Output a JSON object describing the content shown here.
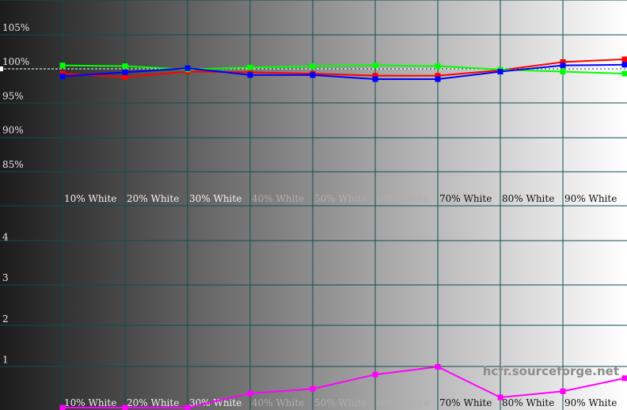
{
  "watermark": "hcfr.sourceforge.net",
  "colors": {
    "grid": "#0f4d4d",
    "red": "#ff0000",
    "green": "#00ff00",
    "blue": "#0000ff",
    "magenta": "#ff00ff",
    "reference": "#ffffff",
    "bg_start": "#1c1c1c",
    "bg_end": "#ffffff"
  },
  "chart_data": [
    {
      "type": "line",
      "categories": [
        "10% White",
        "20% White",
        "30% White",
        "40% White",
        "50% White",
        "60% White",
        "70% White",
        "80% White",
        "90% White"
      ],
      "x": [
        0,
        10,
        20,
        30,
        40,
        50,
        60,
        70,
        80,
        90,
        100
      ],
      "yticks": [
        "105%",
        "100%",
        "95%",
        "90%",
        "85%"
      ],
      "ylim": [
        80,
        110
      ],
      "reference_value": 100,
      "grid": true,
      "series": [
        {
          "color": "red",
          "values": [
            99.3,
            98.8,
            99.6,
            99.5,
            99.3,
            99.0,
            99.0,
            99.8,
            101.0,
            101.4
          ]
        },
        {
          "color": "green",
          "values": [
            100.5,
            100.4,
            99.9,
            100.2,
            100.4,
            100.5,
            100.4,
            99.9,
            99.6,
            99.3
          ]
        },
        {
          "color": "blue",
          "values": [
            98.9,
            99.5,
            100.1,
            99.1,
            99.1,
            98.5,
            98.5,
            99.6,
            100.5,
            100.6
          ]
        }
      ]
    },
    {
      "type": "line",
      "categories": [
        "10% White",
        "20% White",
        "30% White",
        "40% White",
        "50% White",
        "60% White",
        "70% White",
        "80% White",
        "90% White"
      ],
      "x": [
        0,
        10,
        20,
        30,
        40,
        50,
        60,
        70,
        80,
        90,
        100
      ],
      "yticks": [
        "4",
        "3",
        "2",
        "1"
      ],
      "ylim": [
        0,
        5
      ],
      "grid": true,
      "series": [
        {
          "color": "magenta",
          "values": [
            0.0,
            0.0,
            0.0,
            0.35,
            0.46,
            0.81,
            1.0,
            0.25,
            0.4,
            0.72
          ]
        }
      ]
    }
  ]
}
